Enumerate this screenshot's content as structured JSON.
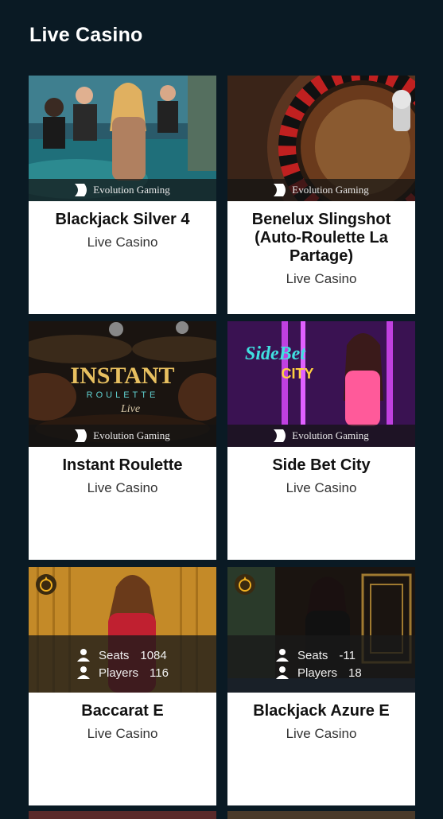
{
  "header": {
    "title": "Live Casino"
  },
  "games": [
    {
      "title": "Blackjack Silver 4",
      "subtitle": "Live Casino",
      "provider": "Evolution Gaming"
    },
    {
      "title": "Benelux Slingshot (Auto-Roulette La Partage)",
      "subtitle": "Live Casino",
      "provider": "Evolution Gaming"
    },
    {
      "title": "Instant Roulette",
      "subtitle": "Live Casino",
      "provider": "Evolution Gaming",
      "art_text": "INSTANT",
      "art_sub": "ROULETTE",
      "art_live": "Live"
    },
    {
      "title": "Side Bet City",
      "subtitle": "Live Casino",
      "provider": "Evolution Gaming",
      "art_text": "SideBet",
      "art_sub": "CITY"
    },
    {
      "title": "Baccarat E",
      "subtitle": "Live Casino",
      "seats_label": "Seats",
      "seats": "1084",
      "players_label": "Players",
      "players": "116"
    },
    {
      "title": "Blackjack Azure E",
      "subtitle": "Live Casino",
      "seats_label": "Seats",
      "seats": "-11",
      "players_label": "Players",
      "players": "18"
    }
  ],
  "colors": {
    "background": "#0a1a24",
    "card": "#ffffff",
    "text": "#111111"
  }
}
